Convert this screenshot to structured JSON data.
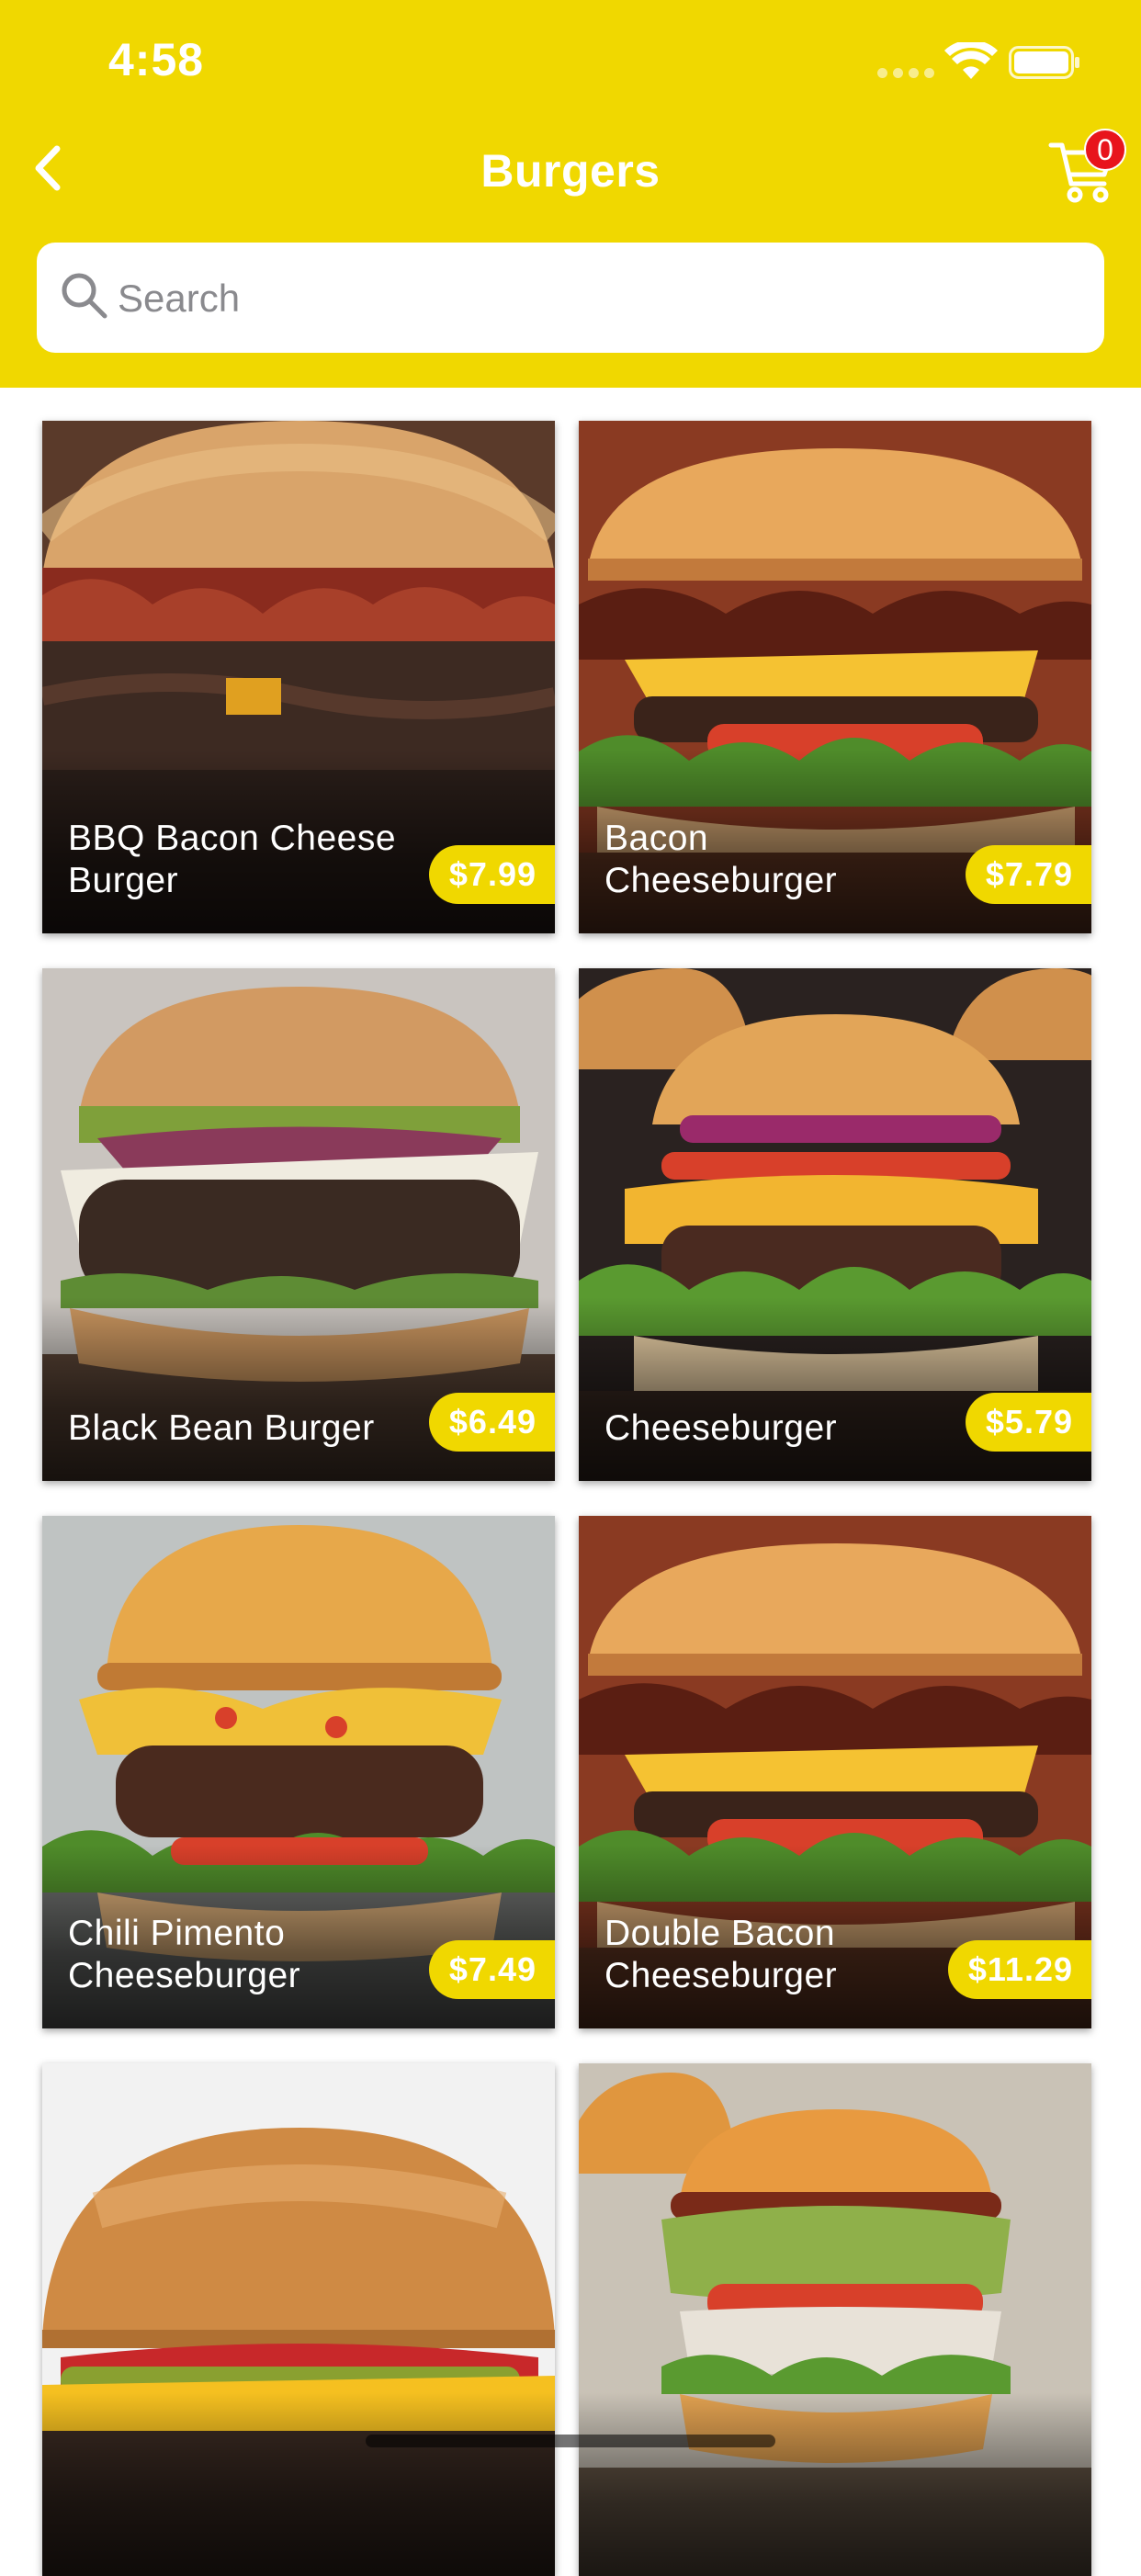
{
  "status_bar": {
    "time": "4:58"
  },
  "header": {
    "title": "Burgers",
    "back_icon": "chevron-left-icon",
    "cart_icon": "cart-icon",
    "cart_count": "0"
  },
  "search": {
    "placeholder": "Search",
    "value": ""
  },
  "colors": {
    "accent": "#F0D800",
    "badge": "#E8141C"
  },
  "products": [
    {
      "name": "BBQ Bacon Cheese Burger",
      "price": "$7.99"
    },
    {
      "name": "Bacon Cheeseburger",
      "price": "$7.79"
    },
    {
      "name": "Black Bean Burger",
      "price": "$6.49"
    },
    {
      "name": "Cheeseburger",
      "price": "$5.79"
    },
    {
      "name": "Chili Pimento Cheeseburger",
      "price": "$7.49"
    },
    {
      "name": "Double Bacon Cheeseburger",
      "price": "$11.29"
    },
    {
      "name": "",
      "price": ""
    },
    {
      "name": "",
      "price": ""
    }
  ]
}
